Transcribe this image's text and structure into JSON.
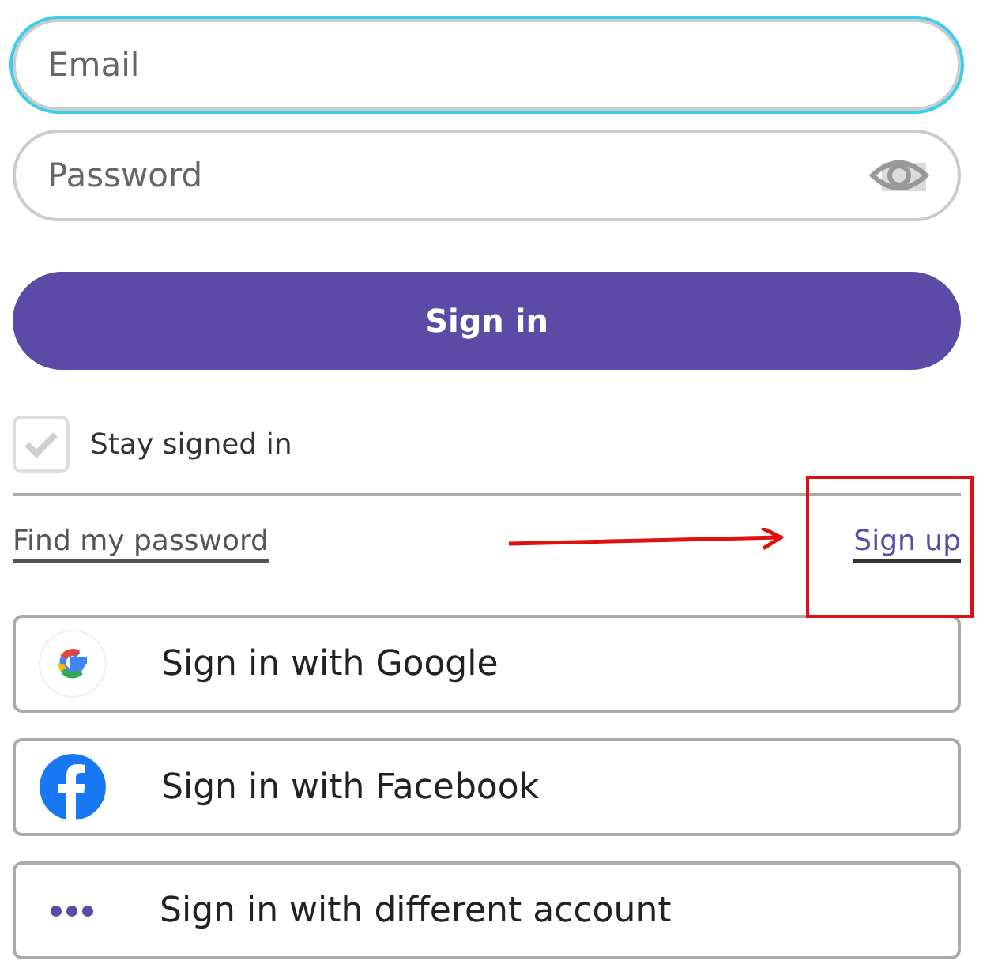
{
  "email_field": {
    "placeholder": "Email",
    "focused": true
  },
  "password_field": {
    "placeholder": "Password"
  },
  "sign_in_button": "Sign in",
  "stay_signed_in": {
    "label": "Stay signed in",
    "checked": false
  },
  "links": {
    "find_password": "Find my password",
    "sign_up": "Sign up"
  },
  "social_buttons": [
    {
      "kind": "google",
      "label": "Sign in with Google"
    },
    {
      "kind": "facebook",
      "label": "Sign in with Facebook"
    },
    {
      "kind": "more",
      "label": "Sign in with different account"
    }
  ]
}
